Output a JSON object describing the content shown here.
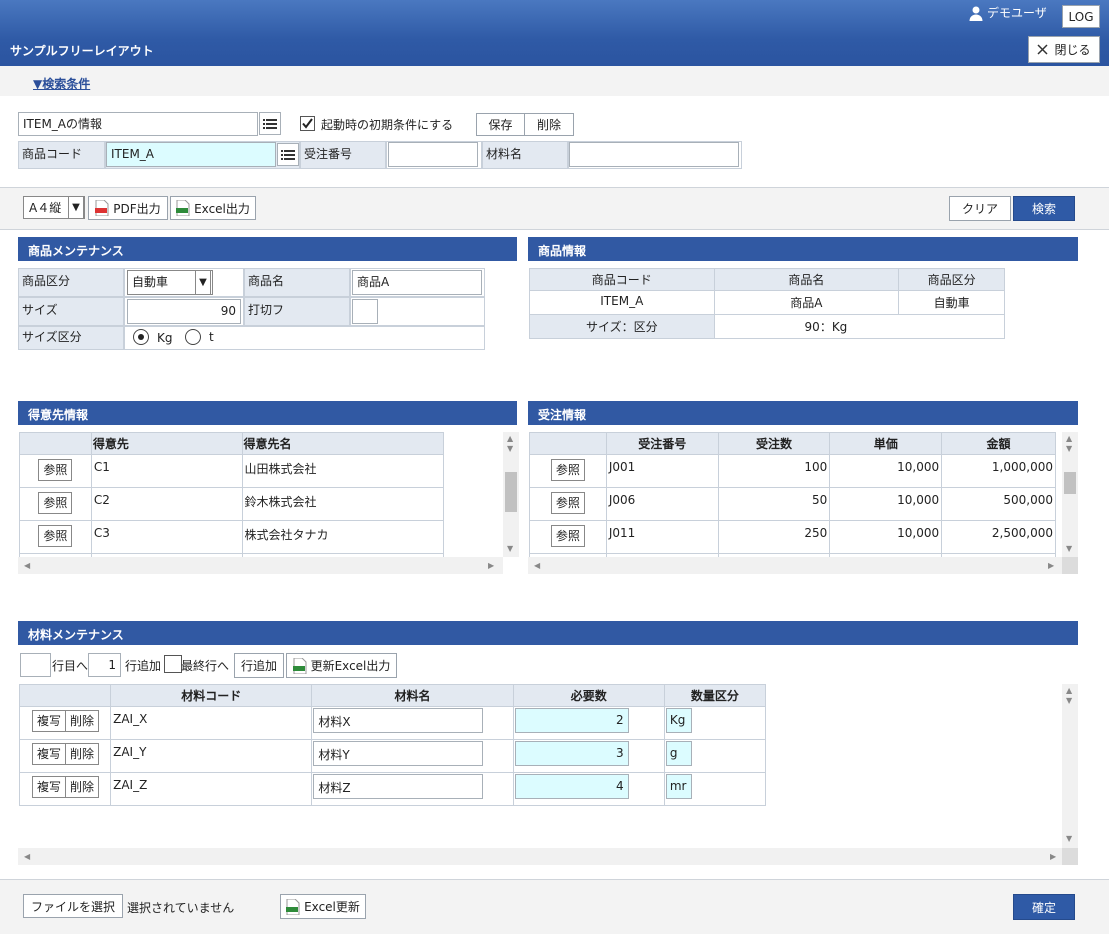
{
  "header": {
    "title": "サンプルフリーレイアウト",
    "user_name": "デモユーザ",
    "log_label": "LOG",
    "close_label": "閉じる"
  },
  "search": {
    "toggle_label": "▼検索条件",
    "condition_name": "ITEM_Aの情報",
    "startup_checkbox_label": "起動時の初期条件にする",
    "startup_checked": true,
    "save_label": "保存",
    "delete_label": "削除",
    "fields": {
      "product_code_label": "商品コード",
      "product_code_value": "ITEM_A",
      "order_no_label": "受注番号",
      "order_no_value": "",
      "material_name_label": "材料名",
      "material_name_value": ""
    }
  },
  "toolbar": {
    "paper_size": "A４縦",
    "pdf_label": "PDF出力",
    "excel_label": "Excel出力",
    "clear_label": "クリア",
    "search_label": "検索"
  },
  "product_maintenance": {
    "title": "商品メンテナンス",
    "category_label": "商品区分",
    "category_value": "自動車",
    "name_label": "商品名",
    "name_value": "商品A",
    "size_label": "サイズ",
    "size_value": "90",
    "discontinued_label": "打切フ",
    "size_unit_label": "サイズ区分",
    "unit_kg": "Kg",
    "unit_t": "t",
    "unit_selected": "Kg"
  },
  "product_info": {
    "title": "商品情報",
    "headers": [
      "商品コード",
      "商品名",
      "商品区分"
    ],
    "row": [
      "ITEM_A",
      "商品A",
      "自動車"
    ],
    "size_label": "サイズ：区分",
    "size_value": "90：Kg"
  },
  "customer_info": {
    "title": "得意先情報",
    "headers": [
      "",
      "得意先",
      "得意先名"
    ],
    "ref_label": "参照",
    "rows": [
      {
        "code": "C1",
        "name": "山田株式会社"
      },
      {
        "code": "C2",
        "name": "鈴木株式会社"
      },
      {
        "code": "C3",
        "name": "株式会社タナカ"
      }
    ]
  },
  "order_info": {
    "title": "受注情報",
    "headers": [
      "",
      "受注番号",
      "受注数",
      "単価",
      "金額"
    ],
    "ref_label": "参照",
    "rows": [
      {
        "no": "J001",
        "qty": "100",
        "price": "10,000",
        "amount": "1,000,000"
      },
      {
        "no": "J006",
        "qty": "50",
        "price": "10,000",
        "amount": "500,000"
      },
      {
        "no": "J011",
        "qty": "250",
        "price": "10,000",
        "amount": "2,500,000"
      }
    ]
  },
  "material_maintenance": {
    "title": "材料メンテナンス",
    "row_goto_value": "",
    "row_goto_label": "行目へ",
    "add_count": "1",
    "add_label": "行追加",
    "last_row_label": "最終行へ",
    "add_row_button": "行追加",
    "excel_update_output": "更新Excel出力",
    "headers": [
      "",
      "材料コード",
      "材料名",
      "必要数",
      "数量区分"
    ],
    "copy_label": "複写",
    "delete_label": "削除",
    "rows": [
      {
        "code": "ZAI_X",
        "name": "材料X",
        "qty": "2",
        "unit": "Kg"
      },
      {
        "code": "ZAI_Y",
        "name": "材料Y",
        "qty": "3",
        "unit": "g"
      },
      {
        "code": "ZAI_Z",
        "name": "材料Z",
        "qty": "4",
        "unit": "mr"
      }
    ]
  },
  "footer": {
    "file_select_label": "ファイルを選択",
    "no_file_label": "選択されていません",
    "excel_update_label": "Excel更新",
    "confirm_label": "確定"
  },
  "colors": {
    "header_blue": "#2f5aa6",
    "section_blue": "#3159a3",
    "highlight_input": "#dcfcff"
  }
}
